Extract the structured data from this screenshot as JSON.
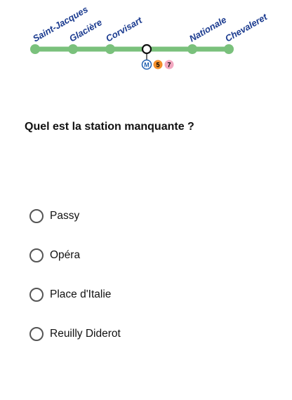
{
  "map": {
    "stations": [
      "Saint-Jacques",
      "Glacière",
      "Corvisart",
      "",
      "Nationale",
      "Chevaleret"
    ],
    "line_color": "#7ac17c",
    "label_color": "#1b3b8f",
    "missing_station_index": 3,
    "correspondences": [
      {
        "label": "M",
        "color": "#1f5fb0",
        "text_color": "#ffffff"
      },
      {
        "label": "5",
        "color": "#f28e2b",
        "text_color": "#000000"
      },
      {
        "label": "7",
        "color": "#f2a7c0",
        "text_color": "#000000"
      }
    ]
  },
  "question": "Quel est la station manquante ?",
  "options": [
    "Passy",
    "Opéra",
    "Place d'Italie",
    "Reuilly Diderot"
  ]
}
